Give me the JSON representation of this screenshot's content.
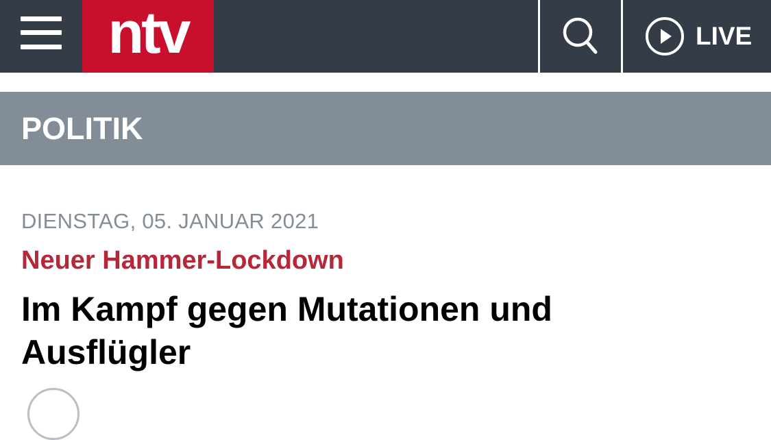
{
  "header": {
    "logo_text": "ntv",
    "live_label": "LIVE",
    "colors": {
      "bar": "#333c47",
      "brand_red": "#c8102e"
    }
  },
  "section": {
    "label": "POLITIK",
    "color": "#838d97"
  },
  "article": {
    "date": "DIENSTAG, 05. JANUAR 2021",
    "kicker": "Neuer Hammer-Lockdown",
    "kicker_color": "#b5283a",
    "headline": "Im Kampf gegen Mutationen und Ausflügler"
  },
  "icons": {
    "menu": "hamburger-menu-icon",
    "search": "search-icon",
    "live": "play-circle-icon"
  }
}
